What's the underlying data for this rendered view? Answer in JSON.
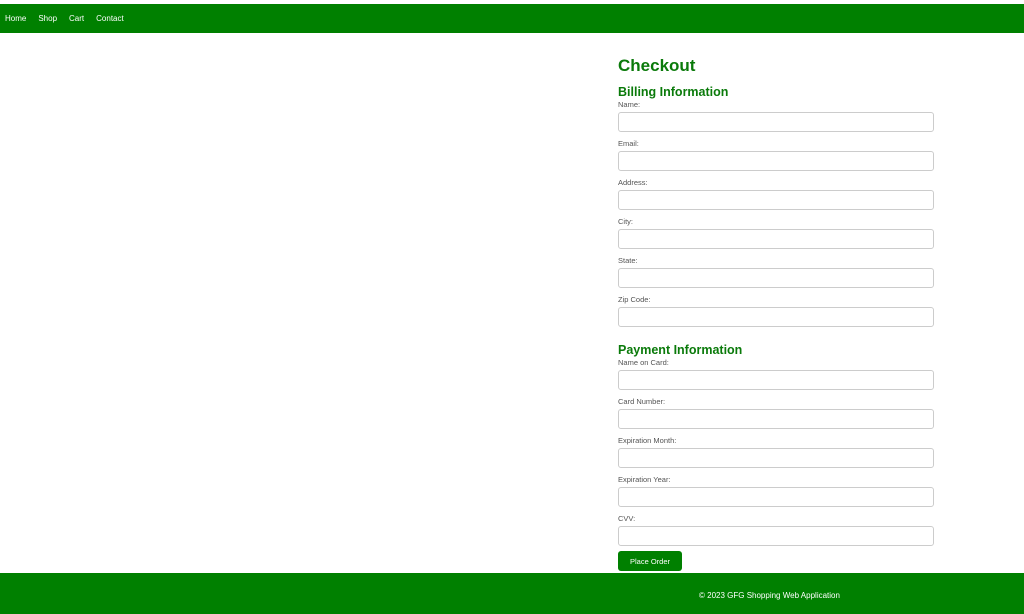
{
  "nav": {
    "items": [
      {
        "label": "Home"
      },
      {
        "label": "Shop"
      },
      {
        "label": "Cart"
      },
      {
        "label": "Contact"
      }
    ]
  },
  "checkout": {
    "title": "Checkout",
    "billing": {
      "heading": "Billing Information",
      "fields": {
        "name": {
          "label": "Name:",
          "value": ""
        },
        "email": {
          "label": "Email:",
          "value": ""
        },
        "address": {
          "label": "Address:",
          "value": ""
        },
        "city": {
          "label": "City:",
          "value": ""
        },
        "state": {
          "label": "State:",
          "value": ""
        },
        "zip": {
          "label": "Zip Code:",
          "value": ""
        }
      }
    },
    "payment": {
      "heading": "Payment Information",
      "fields": {
        "card_name": {
          "label": "Name on Card:",
          "value": ""
        },
        "card_number": {
          "label": "Card Number:",
          "value": ""
        },
        "exp_month": {
          "label": "Expiration Month:",
          "value": ""
        },
        "exp_year": {
          "label": "Expiration Year:",
          "value": ""
        },
        "cvv": {
          "label": "CVV:",
          "value": ""
        }
      }
    },
    "submit_label": "Place Order"
  },
  "footer": {
    "text": "© 2023 GFG Shopping Web Application"
  },
  "colors": {
    "brand_green": "#008000",
    "heading_green": "#0a7a0a"
  }
}
